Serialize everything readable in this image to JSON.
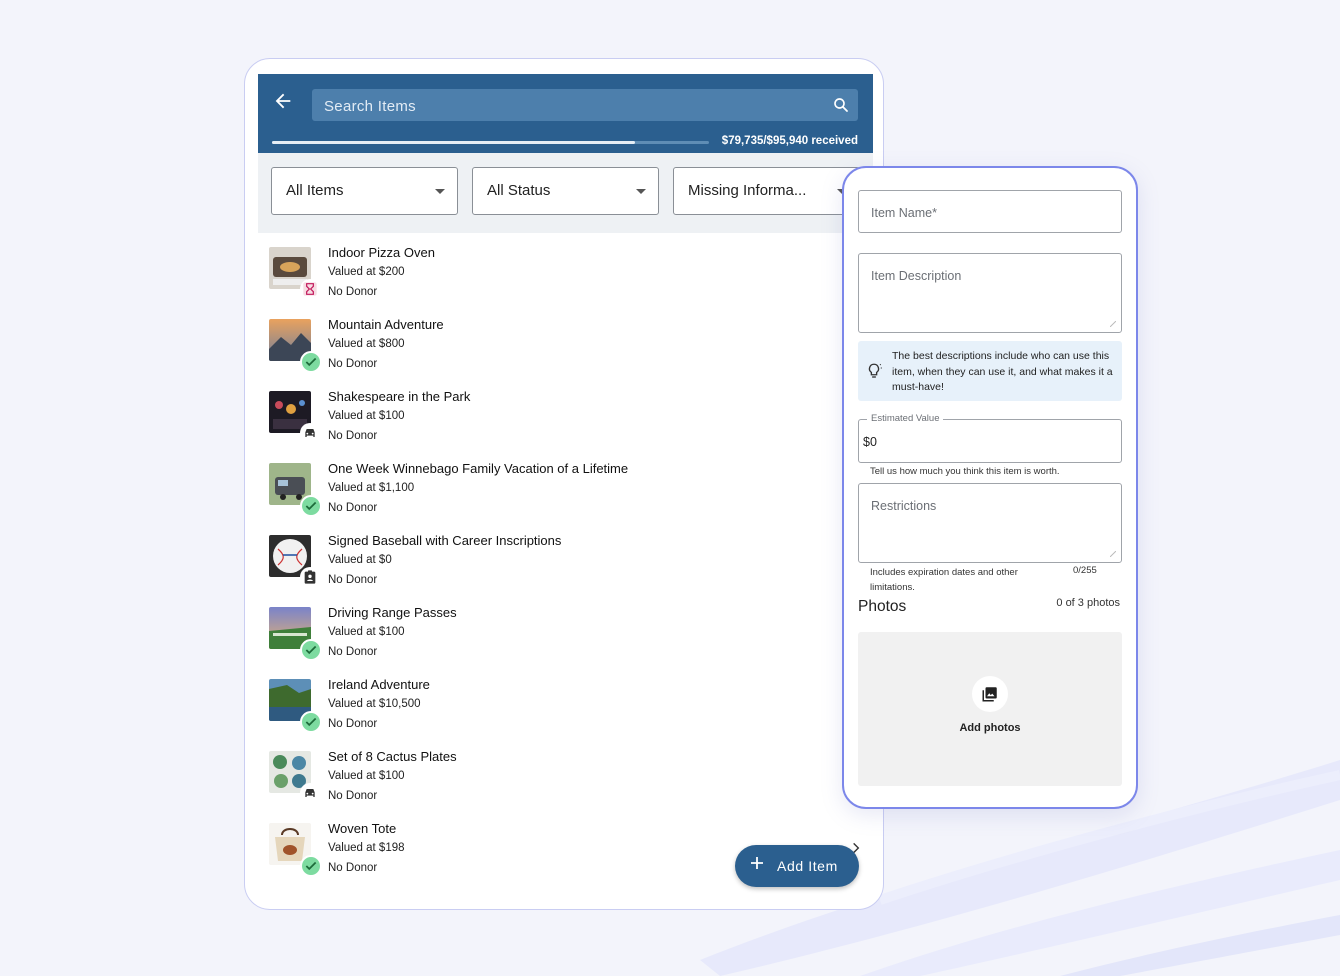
{
  "colors": {
    "primary": "#2b5f8f",
    "header_search": "#4d7fac",
    "accent_border": "#7c87ea",
    "success_badge": "#7ddba0",
    "tip_bg": "#e7f1fa"
  },
  "header": {
    "search_placeholder": "Search Items",
    "progress_text": "$79,735/$95,940 received",
    "progress_fraction": 0.831
  },
  "filters": [
    {
      "label": "All Items"
    },
    {
      "label": "All Status"
    },
    {
      "label": "Missing Informa..."
    }
  ],
  "items": [
    {
      "name": "Indoor Pizza Oven",
      "value": "Valued at $200",
      "donor": "No Donor",
      "status_icon": "hourglass-icon"
    },
    {
      "name": "Mountain Adventure",
      "value": "Valued at $800",
      "donor": "No Donor",
      "status_icon": "check-icon"
    },
    {
      "name": "Shakespeare in the Park",
      "value": "Valued at $100",
      "donor": "No Donor",
      "status_icon": "car-icon"
    },
    {
      "name": "One Week Winnebago Family Vacation of a Lifetime",
      "value": "Valued at $1,100",
      "donor": "No Donor",
      "status_icon": "check-icon"
    },
    {
      "name": "Signed Baseball with Career Inscriptions",
      "value": "Valued at $0",
      "donor": "No Donor",
      "status_icon": "clipboard-person-icon"
    },
    {
      "name": "Driving Range Passes",
      "value": "Valued at $100",
      "donor": "No Donor",
      "status_icon": "check-icon"
    },
    {
      "name": "Ireland Adventure",
      "value": "Valued at $10,500",
      "donor": "No Donor",
      "status_icon": "check-icon"
    },
    {
      "name": "Set of 8 Cactus Plates",
      "value": "Valued at $100",
      "donor": "No Donor",
      "status_icon": "car-icon"
    },
    {
      "name": "Woven Tote",
      "value": "Valued at $198",
      "donor": "No Donor",
      "status_icon": "check-icon"
    }
  ],
  "fab": {
    "label": "Add Item"
  },
  "form": {
    "item_name_placeholder": "Item Name*",
    "item_description_placeholder": "Item Description",
    "tip": "The best descriptions include who can use this item, when they can use it, and what makes it a must-have!",
    "estimated_value_label": "Estimated Value",
    "estimated_value": "$0",
    "estimated_value_helper": "Tell us how much you think this item is worth.",
    "restrictions_placeholder": "Restrictions",
    "restrictions_helper": "Includes expiration dates and other limitations.",
    "restrictions_counter": "0/255",
    "photos_title": "Photos",
    "photos_count": "0 of 3 photos",
    "add_photos_label": "Add photos"
  }
}
